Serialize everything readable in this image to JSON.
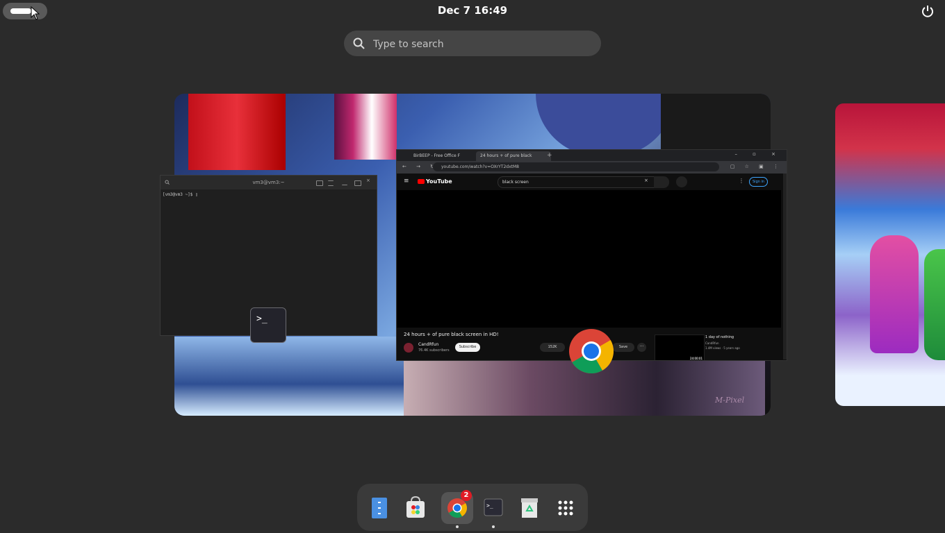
{
  "topbar": {
    "activities_icon": "activities-pill",
    "clock": "Dec 7  16:49",
    "power_icon": "power-icon"
  },
  "search": {
    "placeholder": "Type to search",
    "icon": "search-icon"
  },
  "terminal_window": {
    "title": "vm3@vm3:~",
    "prompt": "[vm3@vm3 ~]$ ▯",
    "app_icon": "terminal-icon"
  },
  "chrome_window": {
    "tabs": [
      "BirBEEP - Free Office F",
      "24 hours + of pure black"
    ],
    "url": "youtube.com/watch?v=OXrYT2dxtM8",
    "youtube": {
      "logo": "YouTube",
      "search_value": "black screen",
      "sign_in": "Sign in",
      "video_title": "24 hours + of pure black screen in HD!",
      "channel": "CandRfun",
      "subscribers": "76.4K subscribers",
      "subscribe": "Subscribe",
      "likes": "152K",
      "save": "Save",
      "more": "···",
      "rec_title": "1 day of nothing",
      "rec_channel": "CandRfun",
      "rec_meta": "1.4M views · 5 years ago",
      "rec_duration": "24:00:01"
    },
    "app_icon": "chrome-icon"
  },
  "wallpaper": {
    "signature": "M-Pixel"
  },
  "dock": {
    "items": [
      {
        "name": "files",
        "icon": "files-icon"
      },
      {
        "name": "software",
        "icon": "software-store-icon"
      },
      {
        "name": "chrome",
        "icon": "chrome-icon",
        "badge": "2",
        "running": true
      },
      {
        "name": "terminal",
        "icon": "terminal-icon",
        "running": true
      },
      {
        "name": "trash",
        "icon": "trash-icon"
      },
      {
        "name": "app-grid",
        "icon": "app-grid-icon"
      }
    ]
  }
}
